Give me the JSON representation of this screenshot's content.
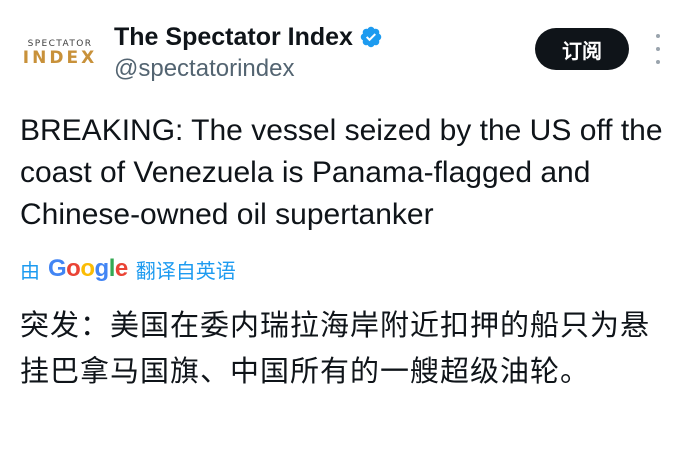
{
  "account": {
    "avatar_line1": "SPECTATOR",
    "avatar_line2": "INDEX",
    "display_name": "The Spectator Index",
    "handle": "@spectatorindex",
    "verified_icon": "verified-badge-icon"
  },
  "actions": {
    "subscribe_label": "订阅",
    "more_icon": "more-options-icon"
  },
  "tweet": {
    "text": "BREAKING: The vessel seized by the US off the coast of Venezuela is Panama-flagged and Chinese-owned oil supertanker"
  },
  "translation": {
    "prefix": "由",
    "provider_letters": [
      "G",
      "o",
      "o",
      "g",
      "l",
      "e"
    ],
    "suffix": "翻译自英语",
    "text": "突发：美国在委内瑞拉海岸附近扣押的船只为悬挂巴拿马国旗、中国所有的一艘超级油轮。"
  },
  "colors": {
    "link_blue": "#1d9bf0",
    "verified_blue": "#1d9bf0",
    "button_bg": "#0f1419",
    "handle_gray": "#536471",
    "avatar_gold": "#c8913a"
  }
}
